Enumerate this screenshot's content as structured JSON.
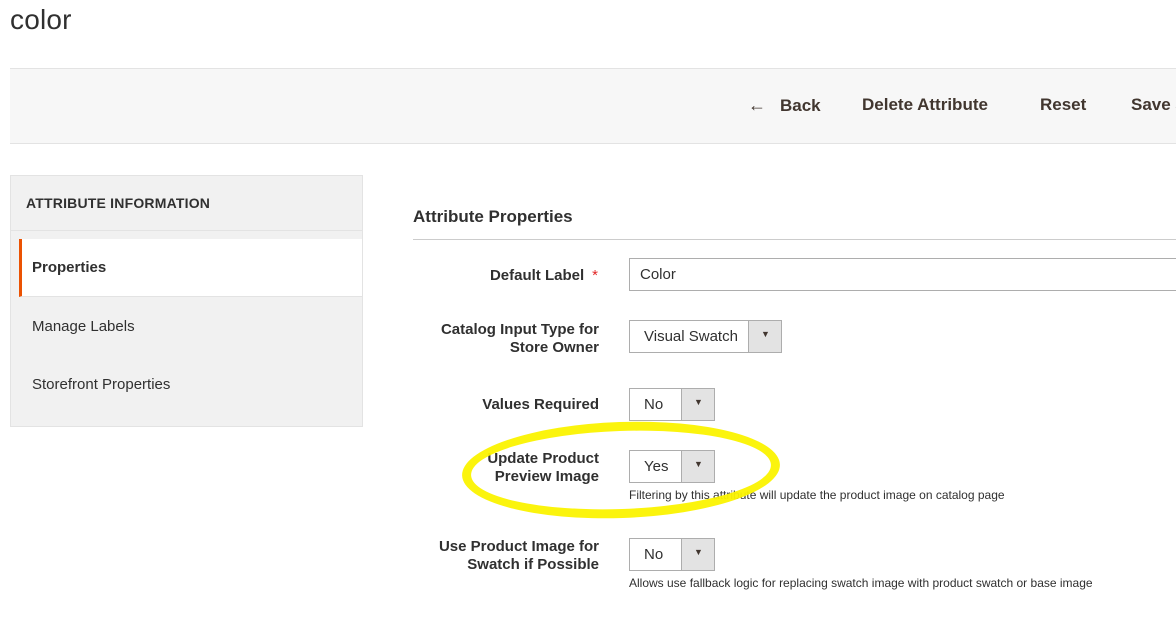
{
  "page": {
    "title": "color"
  },
  "actions": {
    "back": "Back",
    "delete": "Delete Attribute",
    "reset": "Reset",
    "save": "Save a"
  },
  "sidebar": {
    "title": "ATTRIBUTE INFORMATION",
    "items": [
      {
        "label": "Properties",
        "active": true
      },
      {
        "label": "Manage Labels",
        "active": false
      },
      {
        "label": "Storefront Properties",
        "active": false
      }
    ]
  },
  "section": {
    "title": "Attribute Properties"
  },
  "fields": {
    "default_label": {
      "label": "Default Label",
      "required": "*",
      "value": "Color"
    },
    "input_type": {
      "label_1": "Catalog Input Type for",
      "label_2": "Store Owner",
      "value": "Visual Swatch"
    },
    "values_required": {
      "label": "Values Required",
      "value": "No"
    },
    "update_preview": {
      "label_1": "Update Product",
      "label_2": "Preview Image",
      "value": "Yes",
      "note": "Filtering by this attribute will update the product image on catalog page"
    },
    "use_product_image": {
      "label_1": "Use Product Image for",
      "label_2": "Swatch if Possible",
      "value": "No",
      "note": "Allows use fallback logic for replacing swatch image with product swatch or base image"
    }
  },
  "annotation": {
    "highlight_color": "#fbf300"
  },
  "colors": {
    "accent": "#eb5202",
    "required": "#e22626"
  }
}
